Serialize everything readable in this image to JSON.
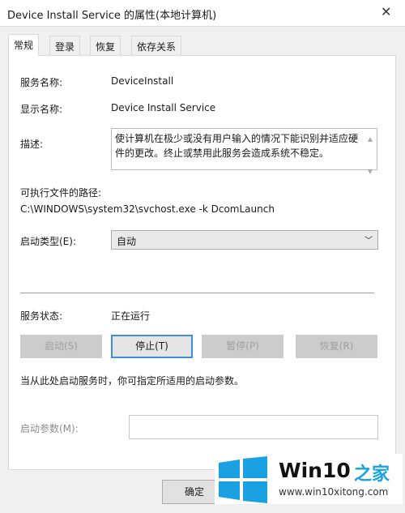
{
  "window": {
    "title": "Device Install Service 的属性(本地计算机)",
    "close_icon": "close-icon"
  },
  "tabs": [
    {
      "label": "常规",
      "active": true
    },
    {
      "label": "登录"
    },
    {
      "label": "恢复"
    },
    {
      "label": "依存关系"
    }
  ],
  "general": {
    "service_name_label": "服务名称:",
    "service_name": "DeviceInstall",
    "display_name_label": "显示名称:",
    "display_name": "Device Install Service",
    "description_label": "描述:",
    "description": "使计算机在极少或没有用户输入的情况下能识别并适应硬件的更改。终止或禁用此服务会造成系统不稳定。",
    "path_label": "可执行文件的路径:",
    "path": "C:\\WINDOWS\\system32\\svchost.exe -k DcomLaunch",
    "startup_type_label": "启动类型(E):",
    "startup_type": "自动",
    "status_label": "服务状态:",
    "status": "正在运行",
    "buttons": {
      "start": "启动(S)",
      "stop": "停止(T)",
      "pause": "暂停(P)",
      "resume": "恢复(R)"
    },
    "hint": "当从此处启动服务时，你可指定所适用的启动参数。",
    "param_label": "启动参数(M):",
    "param_value": ""
  },
  "footer": {
    "ok": "确定"
  },
  "watermark": {
    "brand": "Win10",
    "brand_cn": "之家",
    "url": "www.win10xitong.com",
    "color": "#1aa1e1"
  }
}
